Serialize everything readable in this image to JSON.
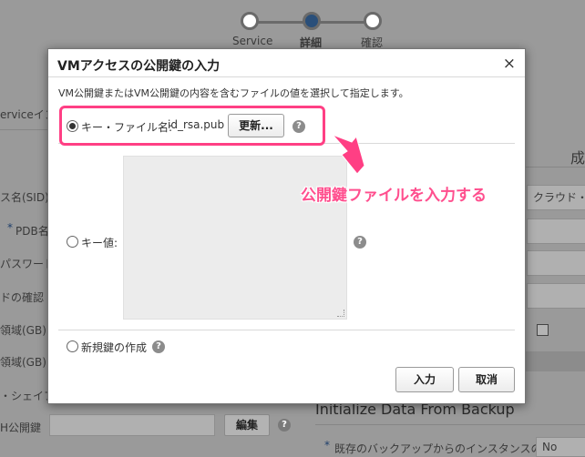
{
  "progress": {
    "steps": [
      "Service",
      "詳細",
      "確認"
    ]
  },
  "background": {
    "left_labels": [
      "erviceイン",
      "ス名(SID)",
      "PDB名",
      "パスワード",
      "ドの確認",
      "領域(GB)",
      "領域(GB)",
      "・シェイプ",
      "H公開鍵"
    ],
    "right_field_value": "クラウド・ス",
    "right_title_fragment": "成",
    "edit_button": "編集",
    "section_title": "Initialize Data From Backup",
    "backup_label": "既存のバックアップからのインスタンスの",
    "backup_value": "No"
  },
  "dialog": {
    "title": "VMアクセスの公開鍵の入力",
    "close": "×",
    "description": "VM公開鍵またはVM公開鍵の内容を含むファイルの値を選択して指定します。",
    "option_file_label": "キー・ファイル名:",
    "file_name": "id_rsa.pub",
    "update_button": "更新...",
    "option_key_label": "キー値:",
    "option_new_label": "新規鍵の作成",
    "ok_button": "入力",
    "cancel_button": "取消",
    "help_glyph": "?"
  },
  "annotation": {
    "text": "公開鍵ファイルを入力する",
    "color": "#ff3f84"
  }
}
